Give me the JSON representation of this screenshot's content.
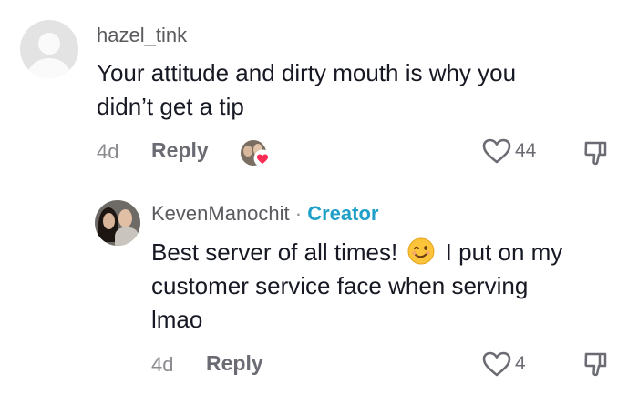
{
  "comments": [
    {
      "username": "hazel_tink",
      "text_line1": "Your attitude and dirty mouth is why you",
      "text_line2": "didn’t get a tip",
      "age": "4d",
      "reply_label": "Reply",
      "likes": "44"
    },
    {
      "username": "KevenManochit",
      "separator": "·",
      "badge": "Creator",
      "text_line1_a": "Best server of all times!",
      "text_line1_b": "I put on my",
      "text_line2": "customer service face when serving",
      "text_line3": "lmao",
      "emoji_icon": "winking-face-emoji",
      "age": "4d",
      "reply_label": "Reply",
      "likes": "4"
    }
  ],
  "colors": {
    "creator_badge": "#20a0c8",
    "heart_badge": "#fe2c55",
    "text_primary": "#161823",
    "text_secondary": "#8a8b91"
  },
  "icons": [
    "default-avatar-icon",
    "heart-outline-icon",
    "dislike-icon",
    "heart-badge-icon"
  ]
}
